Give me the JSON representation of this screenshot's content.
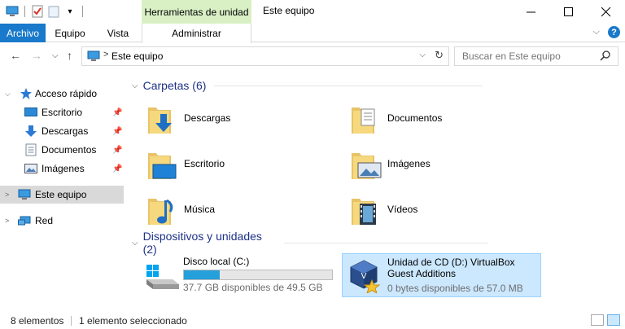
{
  "titlebar": {
    "context_group": "Herramientas de unidad",
    "title": "Este equipo",
    "buttons": [
      "minimize",
      "maximize",
      "close"
    ]
  },
  "ribbon": {
    "tabs": [
      "Archivo",
      "Equipo",
      "Vista",
      "Administrar"
    ],
    "active_tab": "Archivo",
    "accent": "#1979ca",
    "context_color": "#d9f0c5"
  },
  "address": {
    "location": "Este equipo",
    "search_placeholder": "Buscar en Este equipo"
  },
  "sidebar": {
    "quick_access": "Acceso rápido",
    "items": [
      {
        "label": "Escritorio",
        "icon": "desktop-icon",
        "pinned": true
      },
      {
        "label": "Descargas",
        "icon": "download-icon",
        "pinned": true
      },
      {
        "label": "Documentos",
        "icon": "document-icon",
        "pinned": true
      },
      {
        "label": "Imágenes",
        "icon": "pictures-icon",
        "pinned": true
      }
    ],
    "this_pc": "Este equipo",
    "network": "Red"
  },
  "main": {
    "folders_header": "Carpetas (6)",
    "folders": [
      {
        "name": "Descargas",
        "icon": "folder-download-icon"
      },
      {
        "name": "Documentos",
        "icon": "folder-documents-icon"
      },
      {
        "name": "Escritorio",
        "icon": "folder-desktop-icon"
      },
      {
        "name": "Imágenes",
        "icon": "folder-pictures-icon"
      },
      {
        "name": "Música",
        "icon": "folder-music-icon"
      },
      {
        "name": "Vídeos",
        "icon": "folder-videos-icon"
      }
    ],
    "devices_header": "Dispositivos y unidades (2)",
    "drives": [
      {
        "name": "Disco local (C:)",
        "free": "37.7 GB disponibles de 49.5 GB",
        "used_fraction": 0.24,
        "icon": "hard-drive-icon",
        "selected": false
      },
      {
        "name": "Unidad de CD (D:) VirtualBox Guest Additions",
        "free": "0 bytes disponibles de 57.0 MB",
        "icon": "virtualbox-cd-icon",
        "selected": true
      }
    ]
  },
  "status": {
    "count": "8 elementos",
    "selection": "1 elemento seleccionado"
  }
}
